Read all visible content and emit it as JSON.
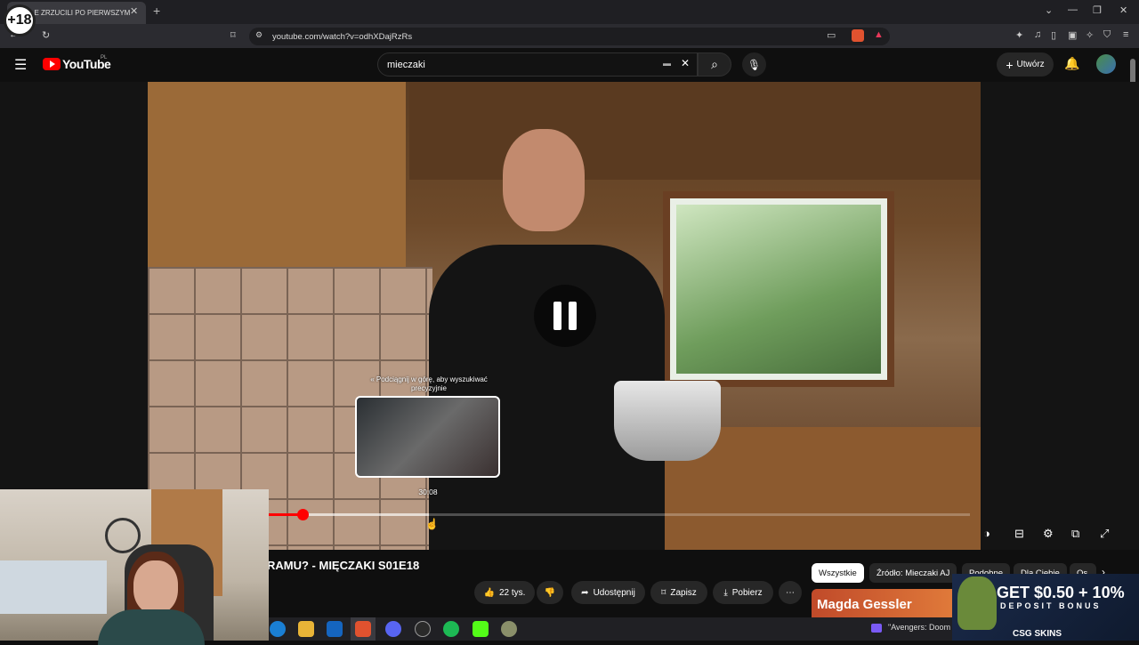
{
  "browser": {
    "tab_title": "ŁE ZRZUCILI PO PIERWSZYM",
    "url": "youtube.com/watch?v=odhXDajRzRs",
    "age_badge": "+18"
  },
  "header": {
    "logo_text": "YouTube",
    "region": "PL",
    "search_value": "mieczaki",
    "create_label": "Utwórz"
  },
  "player": {
    "pull_hint": "Podciągnij w górę, aby wyszukiwać precyzyjnie",
    "preview_time": "30:08",
    "progress_played_fraction": 0.05,
    "progress_hover_fraction": 0.23
  },
  "video": {
    "title": "RAMU? - MIĘCZAKI S01E18"
  },
  "actions": {
    "likes": "22 tys.",
    "share": "Udostępnij",
    "save": "Zapisz",
    "download": "Pobierz"
  },
  "chips": [
    "Wszystkie",
    "Źródło: Mieczaki AJ",
    "Podobne",
    "Dla Ciebie",
    "Os"
  ],
  "sidebar": {
    "thumb_text": "Magda Gessler"
  },
  "ad": {
    "headline": "GET $0.50 + 10%",
    "subline": "DEPOSIT BONUS",
    "brand": "CSG SKINS"
  },
  "taskbar": {
    "now_playing": "\"Avengers: Doom"
  }
}
